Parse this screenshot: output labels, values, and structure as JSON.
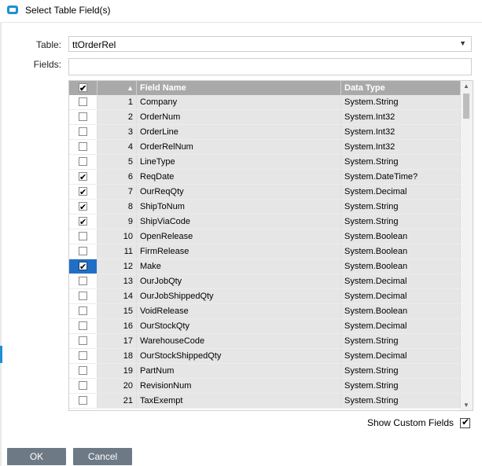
{
  "window": {
    "title": "Select Table Field(s)"
  },
  "form": {
    "table_label": "Table:",
    "table_value": "ttOrderRel",
    "fields_label": "Fields:",
    "fields_value": ""
  },
  "grid": {
    "columns": {
      "name": "Field Name",
      "type": "Data Type"
    },
    "rows": [
      {
        "num": "1",
        "name": "Company",
        "type": "System.String",
        "checked": false
      },
      {
        "num": "2",
        "name": "OrderNum",
        "type": "System.Int32",
        "checked": false
      },
      {
        "num": "3",
        "name": "OrderLine",
        "type": "System.Int32",
        "checked": false
      },
      {
        "num": "4",
        "name": "OrderRelNum",
        "type": "System.Int32",
        "checked": false
      },
      {
        "num": "5",
        "name": "LineType",
        "type": "System.String",
        "checked": false
      },
      {
        "num": "6",
        "name": "ReqDate",
        "type": "System.DateTime?",
        "checked": true
      },
      {
        "num": "7",
        "name": "OurReqQty",
        "type": "System.Decimal",
        "checked": true
      },
      {
        "num": "8",
        "name": "ShipToNum",
        "type": "System.String",
        "checked": true
      },
      {
        "num": "9",
        "name": "ShipViaCode",
        "type": "System.String",
        "checked": true
      },
      {
        "num": "10",
        "name": "OpenRelease",
        "type": "System.Boolean",
        "checked": false
      },
      {
        "num": "11",
        "name": "FirmRelease",
        "type": "System.Boolean",
        "checked": false
      },
      {
        "num": "12",
        "name": "Make",
        "type": "System.Boolean",
        "checked": true,
        "selected": true
      },
      {
        "num": "13",
        "name": "OurJobQty",
        "type": "System.Decimal",
        "checked": false
      },
      {
        "num": "14",
        "name": "OurJobShippedQty",
        "type": "System.Decimal",
        "checked": false
      },
      {
        "num": "15",
        "name": "VoidRelease",
        "type": "System.Boolean",
        "checked": false
      },
      {
        "num": "16",
        "name": "OurStockQty",
        "type": "System.Decimal",
        "checked": false
      },
      {
        "num": "17",
        "name": "WarehouseCode",
        "type": "System.String",
        "checked": false
      },
      {
        "num": "18",
        "name": "OurStockShippedQty",
        "type": "System.Decimal",
        "checked": false
      },
      {
        "num": "19",
        "name": "PartNum",
        "type": "System.String",
        "checked": false
      },
      {
        "num": "20",
        "name": "RevisionNum",
        "type": "System.String",
        "checked": false
      },
      {
        "num": "21",
        "name": "TaxExempt",
        "type": "System.String",
        "checked": false
      }
    ]
  },
  "options": {
    "show_custom_label": "Show Custom Fields",
    "show_custom_checked": true
  },
  "buttons": {
    "ok": "OK",
    "cancel": "Cancel"
  },
  "colors": {
    "header_bg": "#a9a9a9",
    "selected_row": "#1f6fc5",
    "button_bg": "#6d7a86"
  }
}
